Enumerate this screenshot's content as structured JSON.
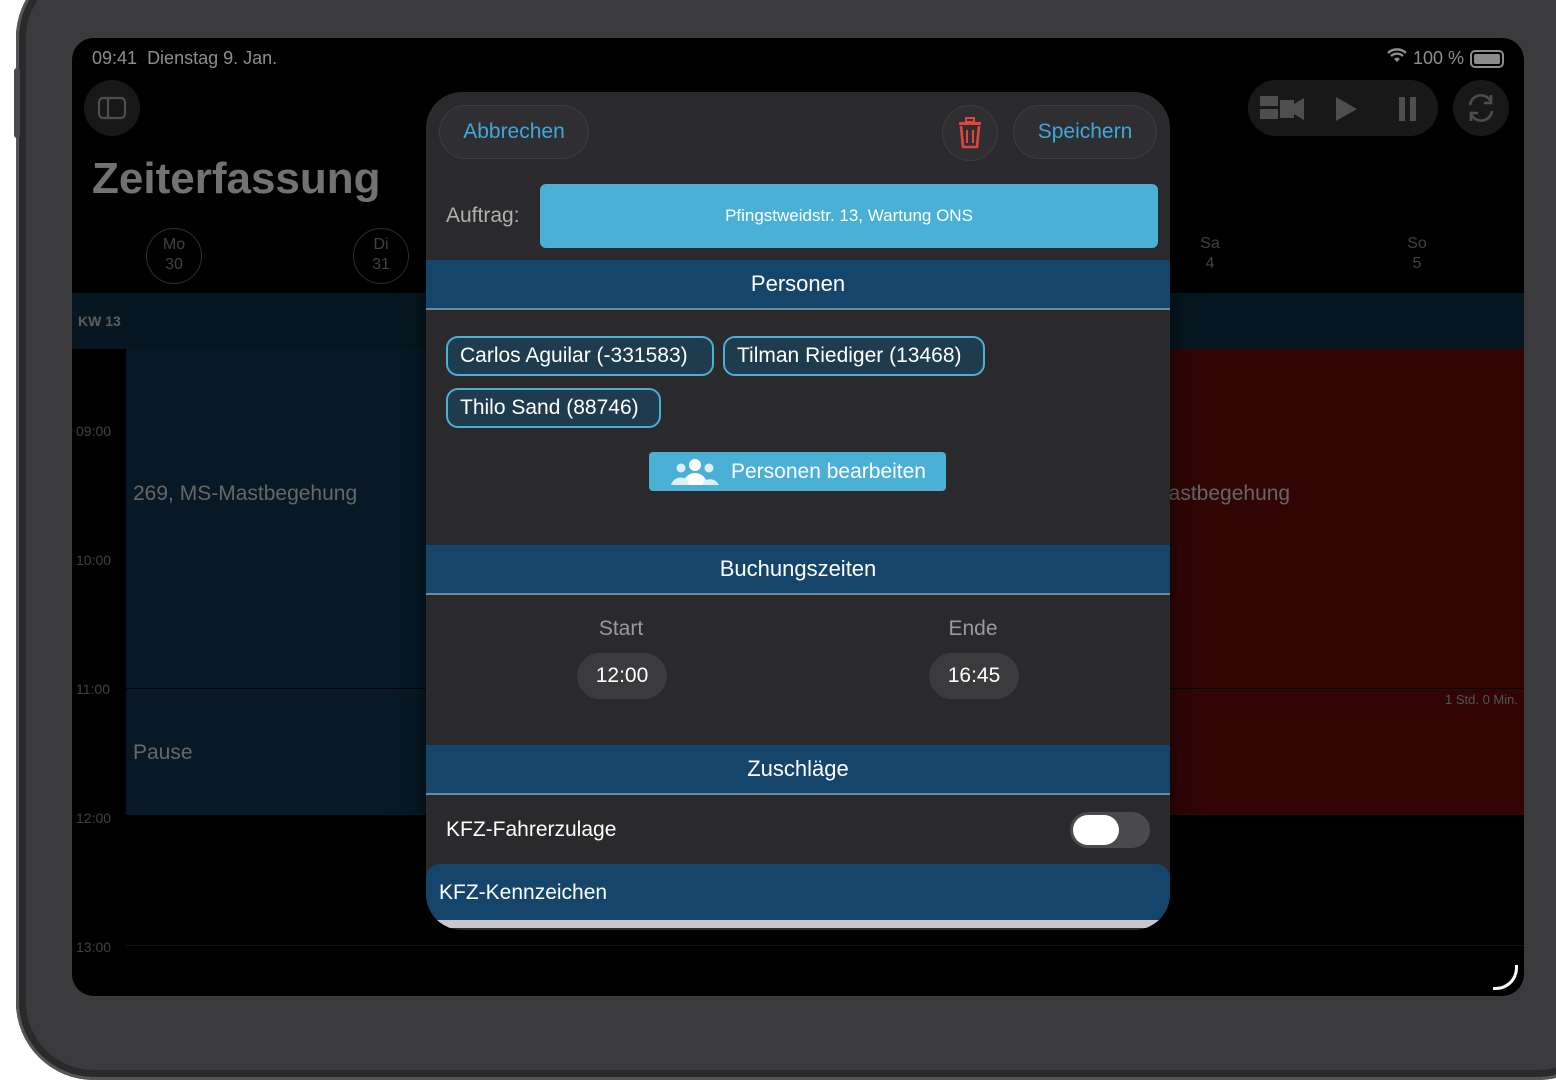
{
  "status_bar": {
    "time": "09:41",
    "date": "Dienstag 9. Jan.",
    "battery": "100 %"
  },
  "app": {
    "title": "Zeiterfassung",
    "week_label": "KW 13",
    "days": [
      {
        "name": "Mo",
        "num": "30"
      },
      {
        "name": "Di",
        "num": "31"
      },
      {
        "name": "Sa",
        "num": "4"
      },
      {
        "name": "So",
        "num": "5"
      }
    ],
    "hours": [
      "09:00",
      "10:00",
      "11:00",
      "12:00",
      "13:00"
    ],
    "blocks": {
      "left_task": "269, MS-Mastbegehung",
      "right_task": "lastbegehung",
      "pause": "Pause",
      "duration": "1 Std. 0 Min."
    }
  },
  "modal": {
    "cancel_label": "Abbrechen",
    "save_label": "Speichern",
    "auftrag_label": "Auftrag:",
    "auftrag_value": "Pfingstweidstr. 13, Wartung ONS",
    "persons_header": "Personen",
    "persons": [
      "Carlos Aguilar (-331583)",
      "Tilman Riediger (13468)",
      "Thilo Sand (88746)"
    ],
    "edit_persons_label": "Personen bearbeiten",
    "times_header": "Buchungszeiten",
    "start_label": "Start",
    "start_value": "12:00",
    "end_label": "Ende",
    "end_value": "16:45",
    "surcharges_header": "Zuschläge",
    "surcharge_item": "KFZ-Fahrerzulage",
    "surcharge_enabled": false,
    "plate_header": "KFZ-Kennzeichen"
  },
  "colors": {
    "accent": "#4ab0d6",
    "section_header": "#15456a",
    "task_block": "#0d2f45",
    "red_block": "#5a0a08",
    "delete": "#e0443a"
  }
}
